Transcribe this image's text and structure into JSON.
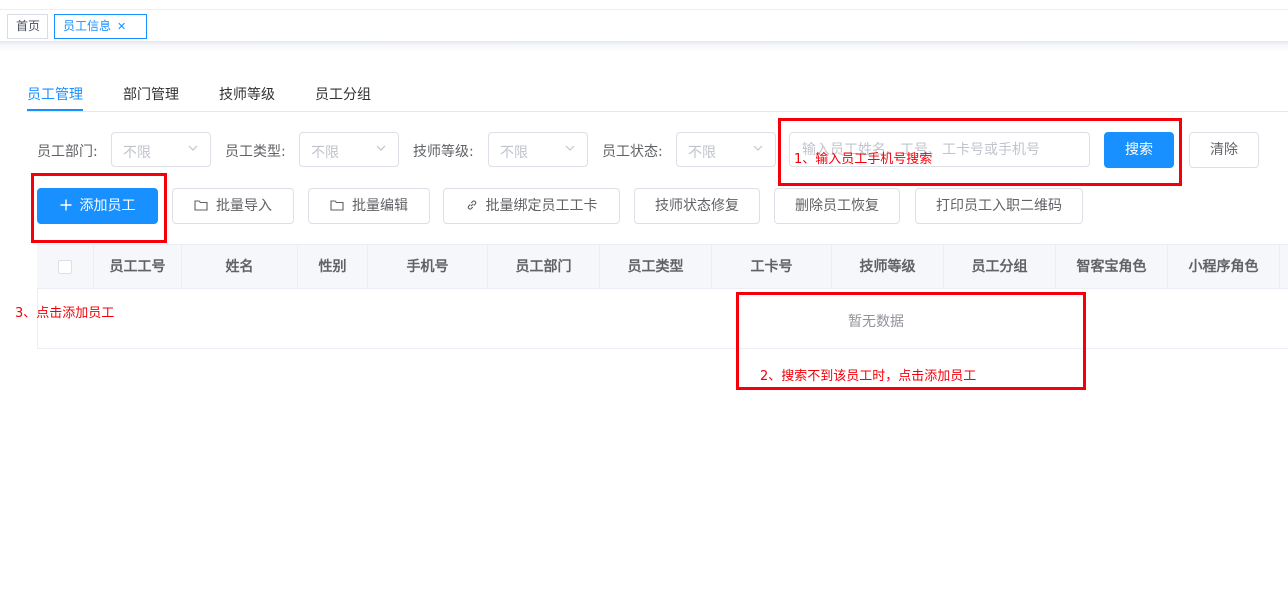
{
  "page_tabs": {
    "home": "首页",
    "active": "员工信息",
    "close_glyph": "✕"
  },
  "sub_tabs": [
    "员工管理",
    "部门管理",
    "技师等级",
    "员工分组"
  ],
  "filters": {
    "dept_label": "员工部门:",
    "type_label": "员工类型:",
    "level_label": "技师等级:",
    "status_label": "员工状态:",
    "select_value": "不限",
    "search_placeholder": "输入员工姓名、工号、工卡号或手机号",
    "search_button": "搜索",
    "clear_button": "清除"
  },
  "actions": {
    "add": "添加员工",
    "import": "批量导入",
    "edit": "批量编辑",
    "bind": "批量绑定员工工卡",
    "repair": "技师状态修复",
    "restore": "删除员工恢复",
    "print": "打印员工入职二维码"
  },
  "table": {
    "columns": [
      "员工工号",
      "姓名",
      "性别",
      "手机号",
      "员工部门",
      "员工类型",
      "工卡号",
      "技师等级",
      "员工分组",
      "智客宝角色",
      "小程序角色"
    ],
    "empty_text": "暂无数据"
  },
  "annotations": {
    "step1": "1、输入员工手机号搜索",
    "step2": "2、搜索不到该员工时，点击添加员工",
    "step3": "3、点击添加员工"
  },
  "colors": {
    "accent": "#1890ff",
    "annotation": "#f5000a"
  },
  "icons": [
    "close-icon",
    "chevron-down-icon",
    "plus-icon",
    "folder-icon",
    "link-icon"
  ]
}
